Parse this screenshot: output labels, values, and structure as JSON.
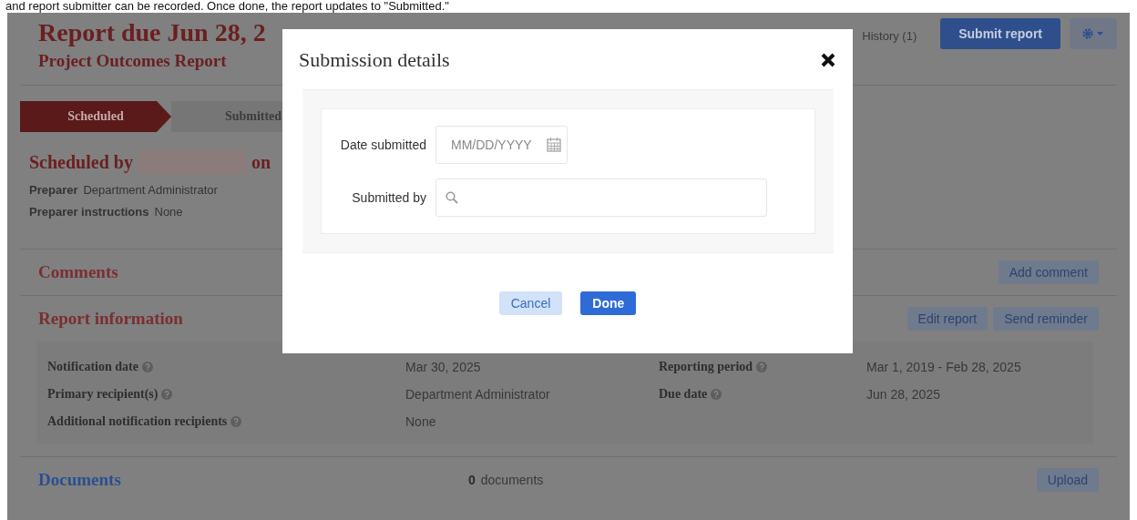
{
  "caption": "and report submitter can be recorded. Once done, the report updates to \"Submitted.\"",
  "header": {
    "title": "Report due Jun 28, 2",
    "subtitle": "Project Outcomes Report",
    "history": "History (1)",
    "submit_button": "Submit report"
  },
  "steps": [
    {
      "label": "Scheduled",
      "selected": true
    },
    {
      "label": "Submitted",
      "selected": false
    }
  ],
  "scheduled": {
    "prefix": "Scheduled by",
    "suffix": "on"
  },
  "preparer": [
    {
      "label": "Preparer",
      "value": "Department Administrator"
    },
    {
      "label": "Preparer instructions",
      "value": "None"
    }
  ],
  "comments": {
    "title": "Comments",
    "button": "Add comment"
  },
  "report_information": {
    "title": "Report information",
    "buttons": [
      "Edit report",
      "Send reminder"
    ],
    "left_fields": [
      {
        "label": "Notification date",
        "value": "Mar 30, 2025"
      },
      {
        "label": "Primary recipient(s)",
        "value": "Department Administrator"
      },
      {
        "label": "Additional notification recipients",
        "value": "None"
      }
    ],
    "right_fields": [
      {
        "label": "Reporting period",
        "value": "Mar 1, 2019 - Feb 28, 2025"
      },
      {
        "label": "Due date",
        "value": "Jun 28, 2025"
      }
    ]
  },
  "documents": {
    "title": "Documents",
    "count": "0",
    "count_label": "documents",
    "button": "Upload"
  },
  "dialog": {
    "title": "Submission details",
    "fields": [
      {
        "label": "Date submitted",
        "kind": "date",
        "placeholder": "MM/DD/YYYY"
      },
      {
        "label": "Submitted by",
        "kind": "search"
      }
    ],
    "buttons": [
      {
        "label": "Cancel",
        "kind": "secondary"
      },
      {
        "label": "Done",
        "kind": "primary"
      }
    ]
  }
}
